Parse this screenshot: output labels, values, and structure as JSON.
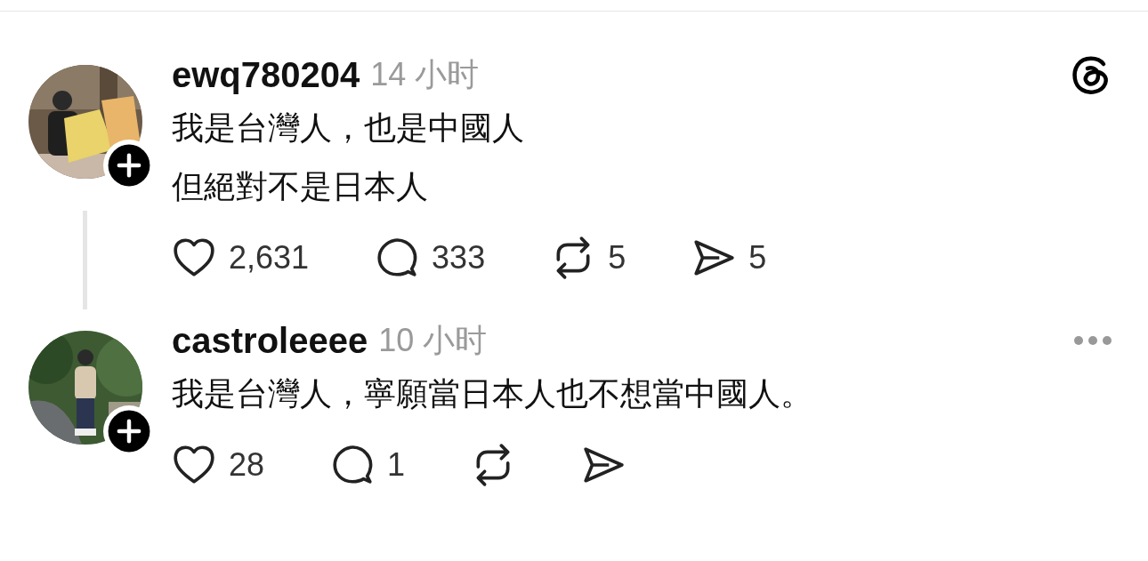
{
  "posts": [
    {
      "username": "ewq780204",
      "time": "14 小时",
      "corner_icon": {
        "kind": "threads_logo"
      },
      "has_replies": true,
      "lines": [
        "我是台灣人，也是中國人",
        "但絕對不是日本人"
      ],
      "actions": [
        {
          "kind": "like",
          "count": "2,631"
        },
        {
          "kind": "comment",
          "count": "333"
        },
        {
          "kind": "repost",
          "count": "5"
        },
        {
          "kind": "share",
          "count": "5"
        }
      ]
    },
    {
      "username": "castroleeee",
      "time": "10 小时",
      "corner_icon": {
        "kind": "more"
      },
      "has_replies": false,
      "lines": [
        "我是台灣人，寧願當日本人也不想當中國人。"
      ],
      "actions": [
        {
          "kind": "like",
          "count": "28"
        },
        {
          "kind": "comment",
          "count": "1"
        },
        {
          "kind": "repost"
        },
        {
          "kind": "share"
        }
      ]
    }
  ]
}
